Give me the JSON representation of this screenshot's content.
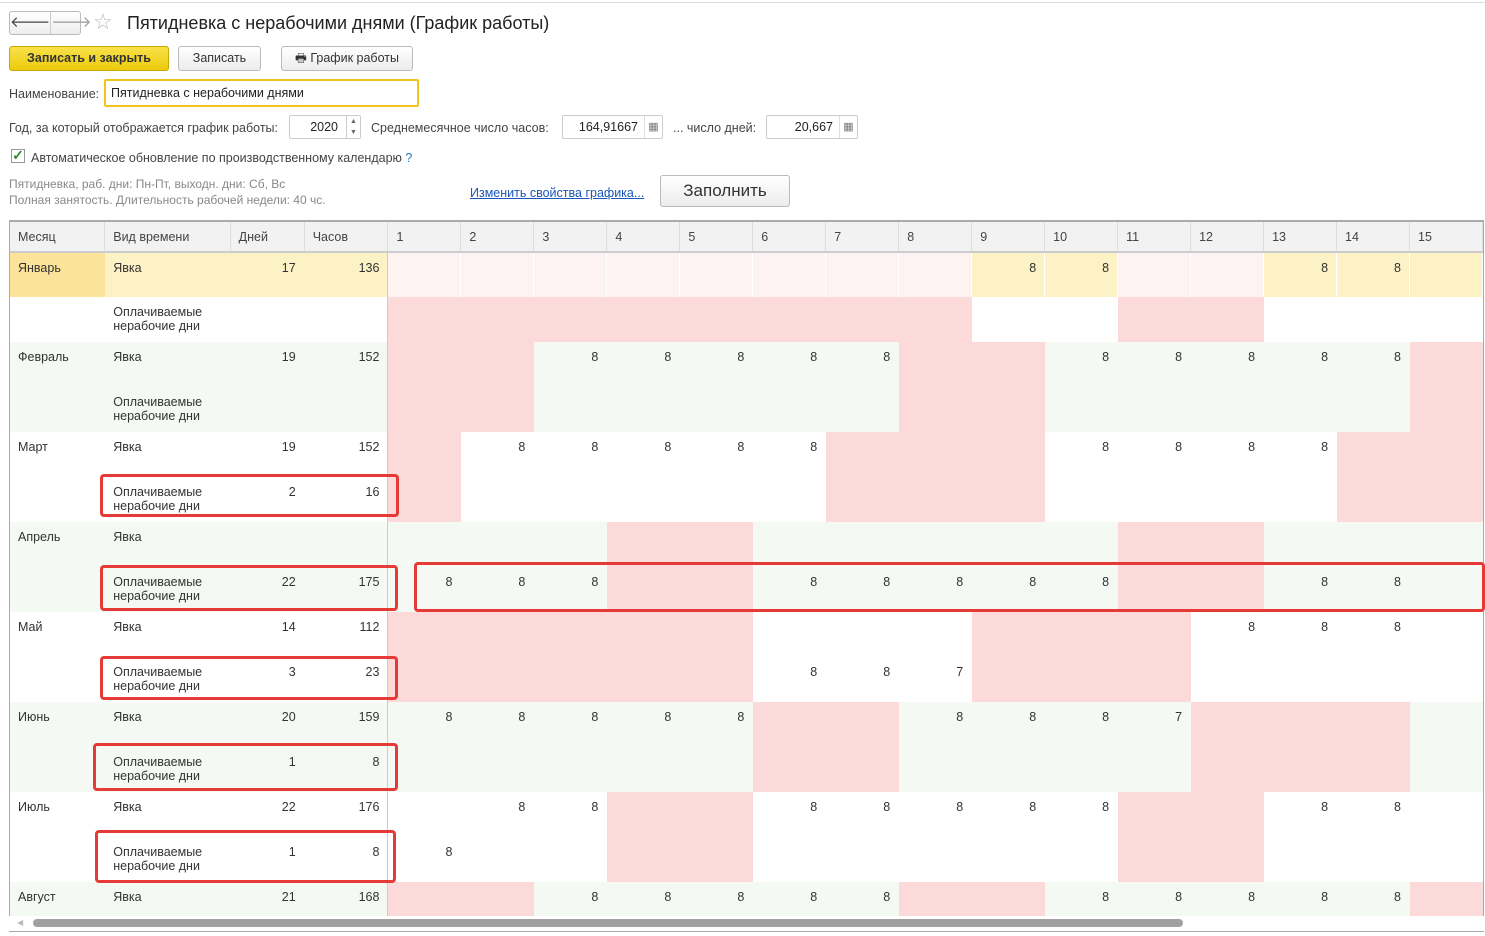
{
  "header": {
    "title": "Пятидневка с нерабочими днями (График работы)",
    "back": "🡐",
    "forward": "🡒",
    "star": "☆"
  },
  "toolbar": {
    "save_close": "Записать и закрыть",
    "save": "Записать",
    "schedule": "График работы",
    "printer_icon": "🖶"
  },
  "form": {
    "name_label": "Наименование:",
    "name_value": "Пятидневка с нерабочими днями",
    "year_label": "Год, за который отображается график работы:",
    "year_value": "2020",
    "avg_hours_label": "Среднемесячное число часов:",
    "avg_hours_value": "164,91667",
    "avg_days_label": "... число дней:",
    "avg_days_value": "20,667",
    "auto_update_label": "Автоматическое обновление по производственному календарю",
    "auto_update_checked": true,
    "help": "?",
    "info_line1": "Пятидневка, раб. дни: Пн-Пт, выходн. дни: Сб, Вс",
    "info_line2": "Полная занятость. Длительность рабочей недели: 40 чс.",
    "change_link": "Изменить свойства графика...",
    "fill_button": "Заполнить"
  },
  "table": {
    "columns": [
      "Месяц",
      "Вид времени",
      "Дней",
      "Часов",
      "1",
      "2",
      "3",
      "4",
      "5",
      "6",
      "7",
      "8",
      "9",
      "10",
      "11",
      "12",
      "13",
      "14",
      "15"
    ],
    "kind_work": "Явка",
    "kind_paid": "Оплачиваемые нерабочие дни",
    "months": [
      {
        "name": "Январь",
        "selected": true,
        "holidays": [
          1,
          2,
          3,
          4,
          5,
          6,
          7,
          8,
          11,
          12
        ],
        "work": {
          "days": "17",
          "hours": "136",
          "values": {
            "9": "8",
            "10": "8",
            "13": "8",
            "14": "8"
          }
        },
        "paid": {
          "days": "",
          "hours": "",
          "values": {}
        }
      },
      {
        "name": "Февраль",
        "holidays": [
          1,
          2,
          8,
          9,
          15
        ],
        "work": {
          "days": "19",
          "hours": "152",
          "values": {
            "3": "8",
            "4": "8",
            "5": "8",
            "6": "8",
            "7": "8",
            "10": "8",
            "11": "8",
            "12": "8",
            "13": "8",
            "14": "8"
          }
        },
        "paid": {
          "days": "",
          "hours": "",
          "values": {}
        }
      },
      {
        "name": "Март",
        "holidays": [
          1,
          7,
          8,
          9,
          14,
          15
        ],
        "work": {
          "days": "19",
          "hours": "152",
          "values": {
            "2": "8",
            "3": "8",
            "4": "8",
            "5": "8",
            "6": "8",
            "10": "8",
            "11": "8",
            "12": "8",
            "13": "8"
          }
        },
        "paid": {
          "days": "2",
          "hours": "16",
          "values": {}
        }
      },
      {
        "name": "Апрель",
        "holidays": [
          4,
          5,
          11,
          12
        ],
        "work": {
          "days": "",
          "hours": "",
          "values": {}
        },
        "paid": {
          "days": "22",
          "hours": "175",
          "values": {
            "1": "8",
            "2": "8",
            "3": "8",
            "6": "8",
            "7": "8",
            "8": "8",
            "9": "8",
            "10": "8",
            "13": "8",
            "14": "8"
          }
        }
      },
      {
        "name": "Май",
        "holidays": [
          1,
          2,
          3,
          4,
          5,
          9,
          10,
          11
        ],
        "work": {
          "days": "14",
          "hours": "112",
          "values": {
            "12": "8",
            "13": "8",
            "14": "8"
          }
        },
        "paid": {
          "days": "3",
          "hours": "23",
          "values": {
            "6": "8",
            "7": "8",
            "8": "7"
          }
        }
      },
      {
        "name": "Июнь",
        "holidays": [
          6,
          7,
          12,
          13,
          14
        ],
        "work": {
          "days": "20",
          "hours": "159",
          "values": {
            "1": "8",
            "2": "8",
            "3": "8",
            "4": "8",
            "5": "8",
            "8": "8",
            "9": "8",
            "10": "8",
            "11": "7"
          }
        },
        "paid": {
          "days": "1",
          "hours": "8",
          "values": {}
        }
      },
      {
        "name": "Июль",
        "holidays": [
          4,
          5,
          11,
          12
        ],
        "work": {
          "days": "22",
          "hours": "176",
          "values": {
            "2": "8",
            "3": "8",
            "6": "8",
            "7": "8",
            "8": "8",
            "9": "8",
            "10": "8",
            "13": "8",
            "14": "8"
          }
        },
        "paid": {
          "days": "1",
          "hours": "8",
          "values": {
            "1": "8"
          }
        }
      },
      {
        "name": "Август",
        "holidays": [
          1,
          2,
          8,
          9,
          15
        ],
        "work": {
          "days": "21",
          "hours": "168",
          "values": {
            "3": "8",
            "4": "8",
            "5": "8",
            "6": "8",
            "7": "8",
            "10": "8",
            "11": "8",
            "12": "8",
            "13": "8",
            "14": "8"
          }
        }
      }
    ]
  }
}
